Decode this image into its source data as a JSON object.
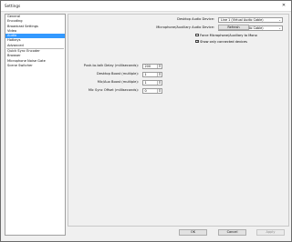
{
  "window": {
    "title": "Settings"
  },
  "sidebar": {
    "items": [
      {
        "label": "General",
        "selected": false
      },
      {
        "label": "Encoding",
        "selected": false
      },
      {
        "label": "Broadcast Settings",
        "selected": false
      },
      {
        "label": "Video",
        "selected": false
      },
      {
        "label": "Audio",
        "selected": true
      },
      {
        "label": "Hotkeys",
        "selected": false
      },
      {
        "label": "Advanced",
        "selected": false
      }
    ],
    "plugin_items": [
      {
        "label": "Quick Sync Encoder"
      },
      {
        "label": "Browser"
      },
      {
        "label": "Microphone Noise Gate"
      },
      {
        "label": "Scene Switcher"
      }
    ]
  },
  "audio": {
    "desktop_label": "Desktop Audio Device:",
    "desktop_value": "Line 1 (Virtual Audio Cable)",
    "mic_label": "Microphone/Auxiliary Audio Device:",
    "mic_value": "Line 2 (Virtual Audio Cable)",
    "refresh_label": "Refresh",
    "force_mono_label": "Force Microphone/Auxiliary to Mono",
    "force_mono_checked": false,
    "show_connected_label": "Show only connected devices",
    "show_connected_checked": true,
    "push_to_talk_label": "Push-to-talk Delay (milliseconds):",
    "push_to_talk_value": "200",
    "desktop_boost_label": "Desktop Boost (multiple):",
    "desktop_boost_value": "1",
    "mic_boost_label": "Mic/Aux Boost (multiple):",
    "mic_boost_value": "1",
    "mic_sync_label": "Mic Sync Offset (milliseconds):",
    "mic_sync_value": "0"
  },
  "footer": {
    "ok_label": "OK",
    "cancel_label": "Cancel",
    "apply_label": "Apply"
  }
}
